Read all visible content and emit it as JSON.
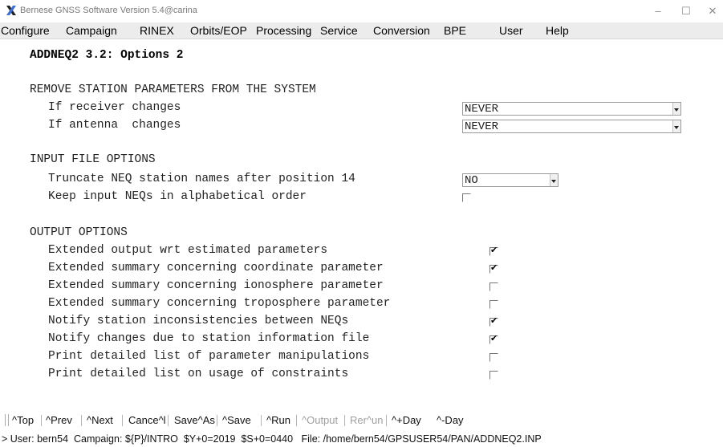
{
  "window": {
    "title": "Bernese GNSS Software Version 5.4@carina",
    "minimize_glyph": "–",
    "maximize_glyph": "☐",
    "close_glyph": "✕"
  },
  "menu": [
    "Configure",
    "Campaign",
    "RINEX",
    "Orbits/EOP",
    "Processing",
    "Service",
    "Conversion",
    "BPE",
    "User",
    "Help"
  ],
  "dialog": {
    "title": "ADDNEQ2 3.2: Options 2",
    "section_remove": {
      "heading": "REMOVE STATION PARAMETERS FROM THE SYSTEM",
      "receiver_label": "If receiver changes",
      "receiver_value": "NEVER",
      "antenna_label": "If antenna  changes",
      "antenna_value": "NEVER"
    },
    "section_input": {
      "heading": "INPUT FILE OPTIONS",
      "truncate_label": "Truncate NEQ station names after position 14",
      "truncate_value": "NO",
      "keep_order_label": "Keep input NEQs in alphabetical order",
      "keep_order_checked": false
    },
    "section_output": {
      "heading": "OUTPUT OPTIONS",
      "options": [
        {
          "label": "Extended output wrt estimated parameters",
          "checked": true
        },
        {
          "label": "Extended summary concerning coordinate parameter",
          "checked": true
        },
        {
          "label": "Extended summary concerning ionosphere parameter",
          "checked": false
        },
        {
          "label": "Extended summary concerning troposphere parameter",
          "checked": false
        },
        {
          "label": "Notify station inconsistencies between NEQs",
          "checked": true
        },
        {
          "label": "Notify changes due to station information file",
          "checked": true
        },
        {
          "label": "Print detailed list of parameter manipulations",
          "checked": false
        },
        {
          "label": "Print detailed list on usage of constraints",
          "checked": false
        }
      ]
    }
  },
  "toolbar": {
    "buttons": [
      {
        "label": "^Top",
        "enabled": true
      },
      {
        "label": "^Prev",
        "enabled": true
      },
      {
        "label": "^Next",
        "enabled": true
      },
      {
        "label": "Cance^l",
        "enabled": true
      },
      {
        "label": "Save^As",
        "enabled": true
      },
      {
        "label": "^Save",
        "enabled": true
      },
      {
        "label": "^Run",
        "enabled": true
      },
      {
        "label": "^Output",
        "enabled": false
      },
      {
        "label": "Rer^un",
        "enabled": false
      },
      {
        "label": "^+Day",
        "enabled": true
      },
      {
        "label": "^-Day",
        "enabled": true
      }
    ]
  },
  "status": {
    "text": "> User: bern54  Campaign: ${P}/INTRO  $Y+0=2019  $S+0=0440   File: /home/bern54/GPSUSER54/PAN/ADDNEQ2.INP"
  },
  "colors": {
    "menubar_bg": "#ececec",
    "disabled_text": "#a0a0a0",
    "icon_black": "#222222",
    "icon_blue": "#3b6fd6"
  },
  "icons": {
    "app": "x-logo-icon",
    "checkmark": "✔"
  }
}
